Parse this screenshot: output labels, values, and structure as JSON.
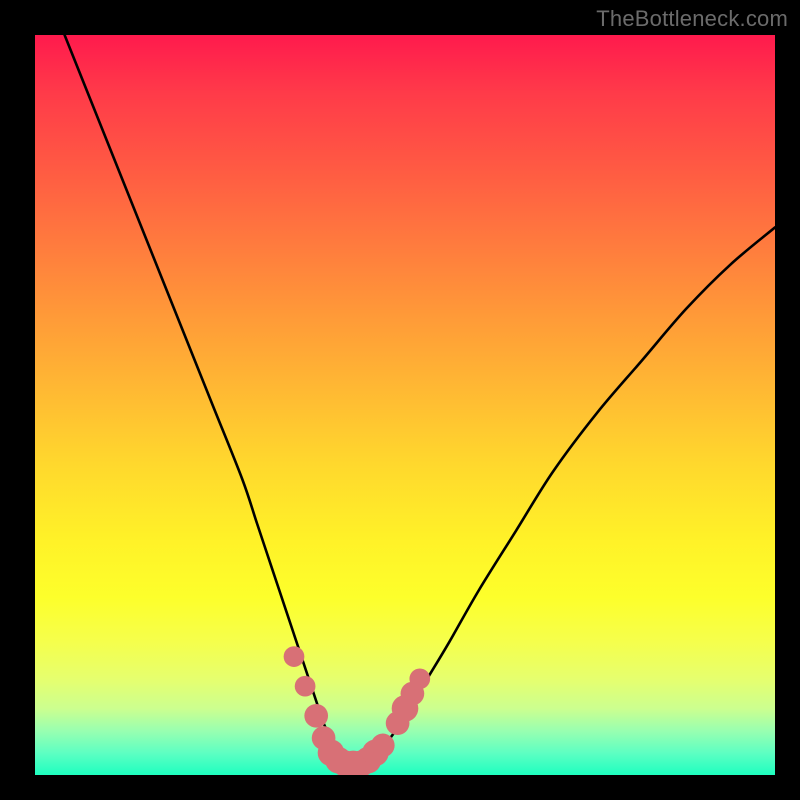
{
  "watermark": "TheBottleneck.com",
  "colors": {
    "frame": "#000000",
    "curve": "#000000",
    "markers": "#d87076",
    "gradient_top": "#ff1a4d",
    "gradient_bottom": "#1effc0"
  },
  "chart_data": {
    "type": "line",
    "title": "",
    "xlabel": "",
    "ylabel": "",
    "xlim": [
      0,
      100
    ],
    "ylim": [
      0,
      100
    ],
    "series": [
      {
        "name": "bottleneck-curve",
        "x": [
          4,
          8,
          12,
          16,
          20,
          24,
          28,
          30,
          32,
          34,
          36,
          38,
          39,
          40,
          41,
          42,
          43,
          44,
          45,
          46,
          48,
          50,
          53,
          56,
          60,
          65,
          70,
          76,
          82,
          88,
          94,
          100
        ],
        "y": [
          100,
          90,
          80,
          70,
          60,
          50,
          40,
          34,
          28,
          22,
          16,
          10,
          7,
          5,
          3,
          2,
          1.5,
          1.5,
          2,
          3,
          5,
          8,
          13,
          18,
          25,
          33,
          41,
          49,
          56,
          63,
          69,
          74
        ]
      }
    ],
    "markers": {
      "name": "highlight-points",
      "shape": "circle",
      "color": "#d87076",
      "points": [
        {
          "x": 35,
          "y": 16,
          "r": 1.4
        },
        {
          "x": 36.5,
          "y": 12,
          "r": 1.4
        },
        {
          "x": 38,
          "y": 8,
          "r": 1.6
        },
        {
          "x": 39,
          "y": 5,
          "r": 1.6
        },
        {
          "x": 40,
          "y": 3,
          "r": 1.8
        },
        {
          "x": 41,
          "y": 2,
          "r": 1.8
        },
        {
          "x": 42,
          "y": 1.5,
          "r": 1.8
        },
        {
          "x": 43,
          "y": 1.5,
          "r": 1.8
        },
        {
          "x": 44,
          "y": 1.5,
          "r": 1.8
        },
        {
          "x": 45,
          "y": 2,
          "r": 1.8
        },
        {
          "x": 46,
          "y": 3,
          "r": 1.8
        },
        {
          "x": 47,
          "y": 4,
          "r": 1.6
        },
        {
          "x": 49,
          "y": 7,
          "r": 1.6
        },
        {
          "x": 50,
          "y": 9,
          "r": 1.8
        },
        {
          "x": 51,
          "y": 11,
          "r": 1.6
        },
        {
          "x": 52,
          "y": 13,
          "r": 1.4
        }
      ]
    }
  }
}
